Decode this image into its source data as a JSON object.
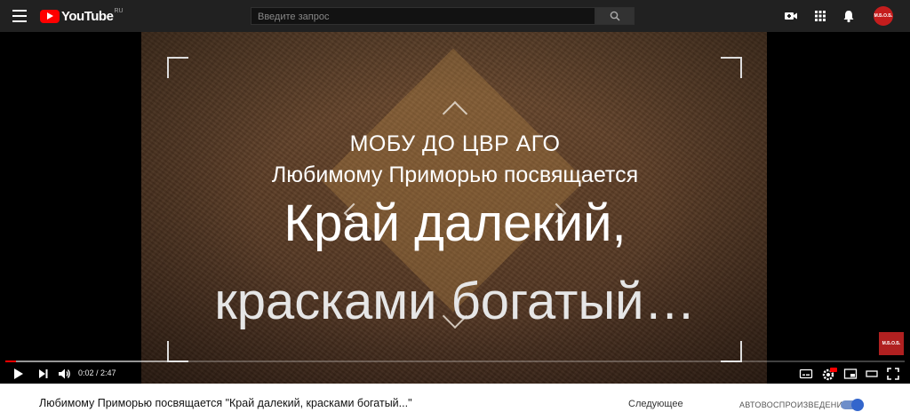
{
  "header": {
    "logo_text": "YouTube",
    "logo_region": "RU",
    "search_placeholder": "Введите запрос",
    "avatar_text": "М.Б.О.Б."
  },
  "video": {
    "line1": "МОБУ ДО ЦВР АГО",
    "line2": "Любимому Приморью посвящается",
    "line3": "Край далекий,",
    "line4": "красками богатый…",
    "watermark_text": "М.Б.О.Б."
  },
  "player": {
    "current_time": "0:02",
    "duration": "2:47",
    "time_display": "0:02 / 2:47",
    "progress_fraction": 0.012,
    "loaded_fraction": 0.18
  },
  "info": {
    "title": "Любимому Приморью посвящается \"Край далекий, красками богатый...\"",
    "next_label": "Следующее",
    "autoplay_label": "АВТОВОСПРОИЗВЕДЕНИЕ",
    "autoplay_on": true
  },
  "colors": {
    "topbar": "#212121",
    "accent_red": "#ff0000",
    "toggle_blue": "#3366cc"
  }
}
